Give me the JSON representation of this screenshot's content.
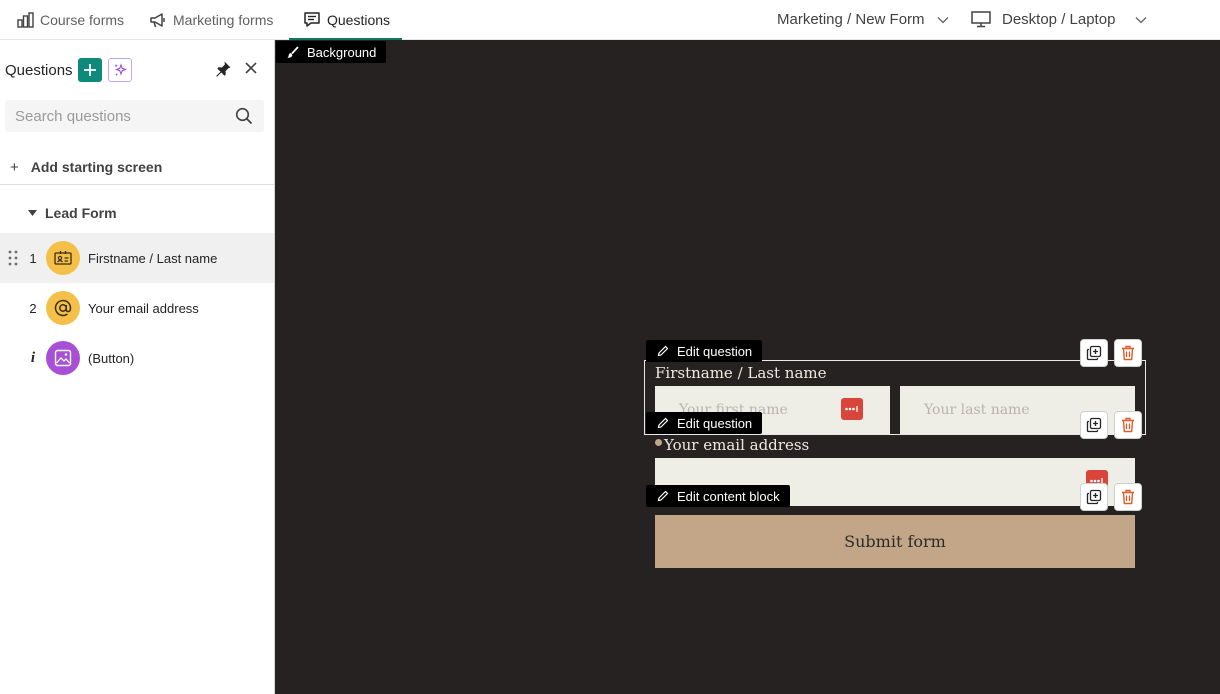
{
  "topbar": {
    "tabs": [
      {
        "label": "Course forms",
        "icon": "bar-chart-icon"
      },
      {
        "label": "Marketing forms",
        "icon": "megaphone-icon"
      },
      {
        "label": "Questions",
        "icon": "form-questions-icon",
        "active": true
      }
    ],
    "form_selector": "Marketing / New Form",
    "device_selector": "Desktop / Laptop"
  },
  "sidebar": {
    "title": "Questions",
    "search_placeholder": "Search questions",
    "add_starting_screen": "Add starting screen",
    "section": "Lead Form",
    "questions": [
      {
        "number": "1",
        "label": "Firstname / Last name",
        "icon": "contact-card-icon",
        "icon_color": "#f5c04a",
        "selected": true
      },
      {
        "number": "2",
        "label": "Your email address",
        "icon": "at-sign-icon",
        "icon_color": "#f5c04a"
      },
      {
        "number": "i",
        "label": "(Button)",
        "icon": "image-icon",
        "icon_color": "#a94fd6"
      }
    ]
  },
  "canvas": {
    "background_tag": "Background",
    "edit_question_tag": "Edit question",
    "edit_content_block_tag": "Edit content block",
    "q1_label": "Firstname / Last name",
    "firstname_placeholder": "Your first name",
    "lastname_placeholder": "Your last name",
    "q2_label": "Your email address",
    "submit_label": "Submit form"
  },
  "colors": {
    "accent": "#0f8a7a",
    "canvas_bg": "#272222",
    "field_bg": "#eeede6",
    "submit_bg": "#c3a587",
    "delete_icon": "#e05a2b"
  }
}
